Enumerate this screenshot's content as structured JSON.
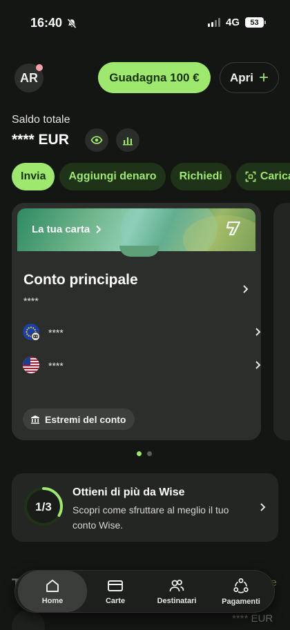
{
  "status_bar": {
    "time": "16:40",
    "network": "4G",
    "battery": "53"
  },
  "header": {
    "avatar_initials": "AR",
    "earn_label": "Guadagna 100 €",
    "open_label": "Apri",
    "open_plus": "+"
  },
  "balance": {
    "label": "Saldo totale",
    "value": "**** EUR"
  },
  "actions": [
    {
      "label": "Invia"
    },
    {
      "label": "Aggiungi denaro"
    },
    {
      "label": "Richiedi"
    },
    {
      "label": "Carica"
    }
  ],
  "account_card": {
    "banner_label": "La tua carta",
    "title": "Conto principale",
    "masked": "****",
    "currencies": [
      {
        "flag": "eu-flag",
        "masked": "****"
      },
      {
        "flag": "us-flag",
        "masked": "****"
      }
    ],
    "details_label": "Estremi del conto"
  },
  "promo": {
    "progress": "1/3",
    "progress_fraction": 0.3333,
    "title": "Ottieni di più da Wise",
    "description": "Scopri come sfruttare al meglio il tuo conto Wise."
  },
  "below_fold": {
    "heading_partial": "T",
    "right_partial": "e",
    "amount": "**** EUR"
  },
  "tab_bar": [
    {
      "label": "Home",
      "icon": "home-icon"
    },
    {
      "label": "Carte",
      "icon": "card-icon"
    },
    {
      "label": "Destinatari",
      "icon": "recipients-icon"
    },
    {
      "label": "Pagamenti",
      "icon": "payments-icon"
    }
  ],
  "colors": {
    "accent": "#9fe870",
    "accent_dark": "#163300",
    "background": "#141614",
    "card": "#2c2e2b"
  }
}
